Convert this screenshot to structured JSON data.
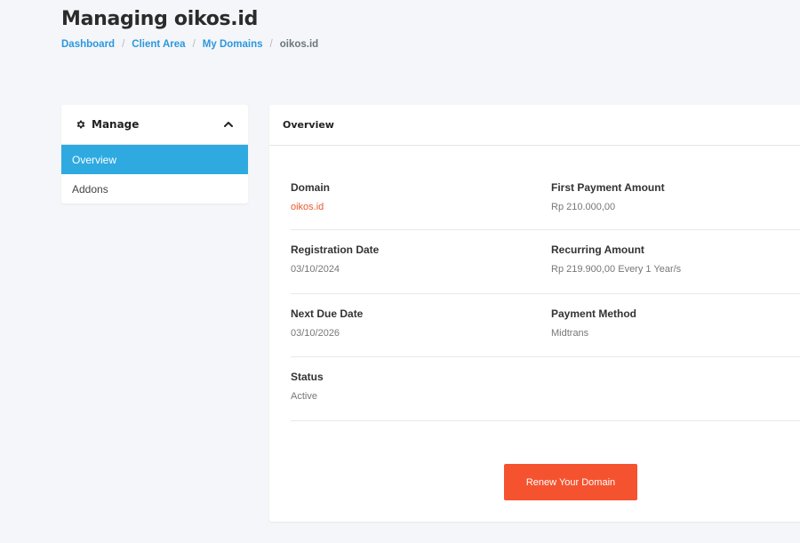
{
  "page": {
    "title": "Managing oikos.id"
  },
  "breadcrumb": {
    "items": [
      "Dashboard",
      "Client Area",
      "My Domains"
    ],
    "current": "oikos.id",
    "separator": "/"
  },
  "sidebar": {
    "title": "Manage",
    "icon": "gear-icon",
    "collapse_icon": "chevron-up-icon",
    "items": [
      {
        "label": "Overview",
        "active": true
      },
      {
        "label": "Addons",
        "active": false
      }
    ]
  },
  "overview": {
    "title": "Overview",
    "fields": {
      "domain": {
        "label": "Domain",
        "value": "oikos.id"
      },
      "first_payment": {
        "label": "First Payment Amount",
        "value": "Rp 210.000,00"
      },
      "registration_date": {
        "label": "Registration Date",
        "value": "03/10/2024"
      },
      "recurring_amount": {
        "label": "Recurring Amount",
        "value": "Rp 219.900,00 Every 1 Year/s"
      },
      "next_due_date": {
        "label": "Next Due Date",
        "value": "03/10/2026"
      },
      "payment_method": {
        "label": "Payment Method",
        "value": "Midtrans"
      },
      "status": {
        "label": "Status",
        "value": "Active"
      }
    },
    "renew_label": "Renew Your Domain"
  },
  "colors": {
    "accent_blue": "#2eaae1",
    "link_blue": "#2c97de",
    "action_orange": "#f5532f",
    "domain_link": "#ea5a2e"
  }
}
